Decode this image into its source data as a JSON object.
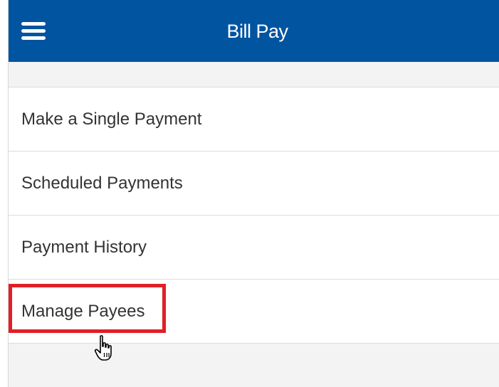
{
  "header": {
    "title": "Bill Pay",
    "menu_icon": "hamburger-menu-icon",
    "background_color": "#0054a0"
  },
  "menu": {
    "items": [
      {
        "label": "Make a Single Payment"
      },
      {
        "label": "Scheduled Payments"
      },
      {
        "label": "Payment History"
      },
      {
        "label": "Manage Payees"
      }
    ]
  },
  "highlight": {
    "target": "Manage Payees",
    "color": "#e01f26"
  },
  "cursor": {
    "icon": "hand-pointer-icon"
  }
}
